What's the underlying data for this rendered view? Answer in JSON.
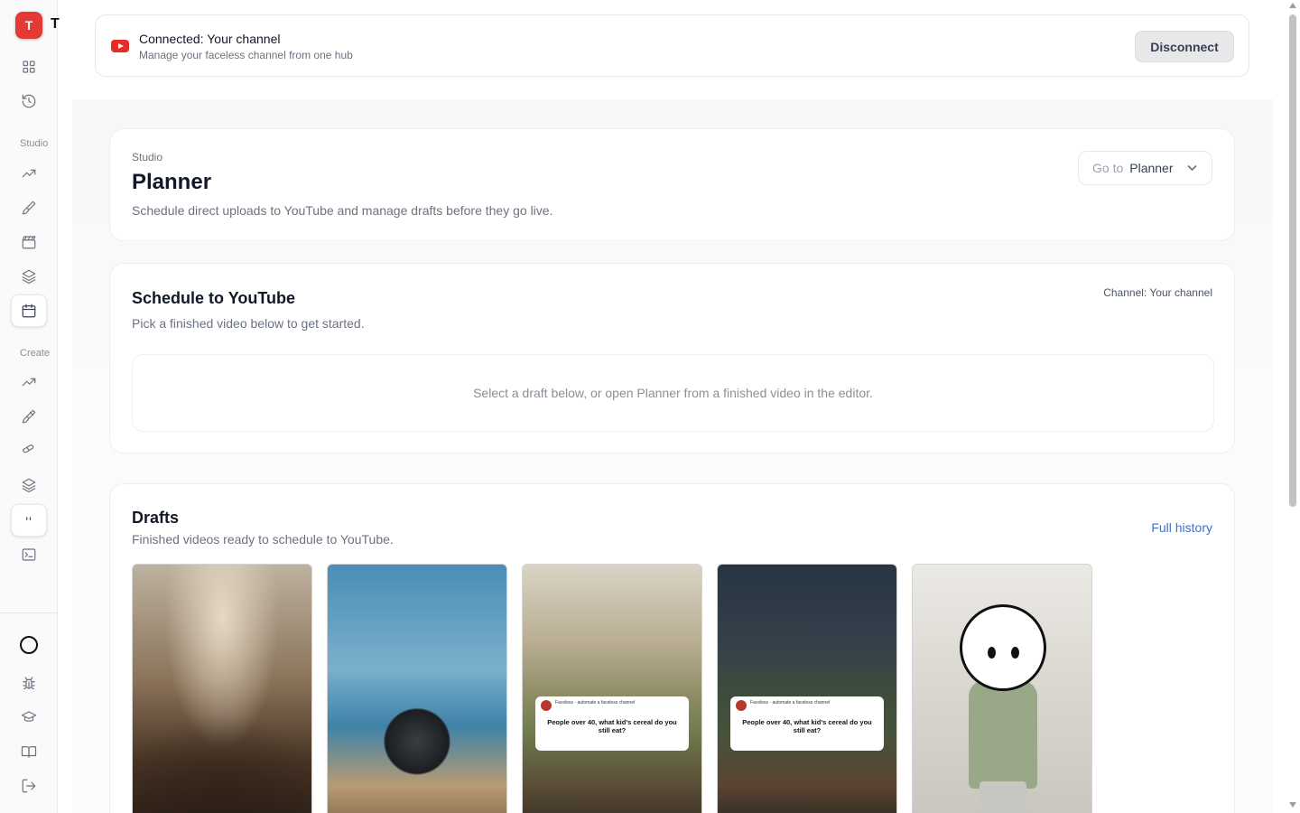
{
  "app": {
    "logo_letter": "T",
    "logo_text": "T"
  },
  "sidebar": {
    "section_studio": "Studio",
    "section_create": "Create",
    "items": [
      {
        "name": "dashboard",
        "icon": "grid-icon"
      },
      {
        "name": "history",
        "icon": "history-icon"
      },
      {
        "name": "trends",
        "icon": "trending-up-icon"
      },
      {
        "name": "brush",
        "icon": "brush-icon"
      },
      {
        "name": "clapper",
        "icon": "clapperboard-icon"
      },
      {
        "name": "layers",
        "icon": "layers-icon"
      },
      {
        "name": "planner",
        "icon": "calendar-icon",
        "active": true
      },
      {
        "name": "create-trends",
        "icon": "trending-up-icon"
      },
      {
        "name": "create-brush",
        "icon": "paintbrush-icon"
      },
      {
        "name": "create-link",
        "icon": "link-icon"
      },
      {
        "name": "create-layers",
        "icon": "layers-icon"
      },
      {
        "name": "quote",
        "icon": "quote-icon"
      },
      {
        "name": "terminal",
        "icon": "terminal-icon"
      },
      {
        "name": "bug",
        "icon": "bug-icon"
      },
      {
        "name": "learn",
        "icon": "graduation-cap-icon"
      },
      {
        "name": "docs",
        "icon": "book-icon"
      },
      {
        "name": "logout",
        "icon": "log-out-icon"
      }
    ]
  },
  "connection": {
    "title": "Connected: Your channel",
    "subtitle": "Manage your faceless channel from one hub",
    "disconnect_label": "Disconnect",
    "brand_color": "#e52d27"
  },
  "planner": {
    "eyebrow": "Studio",
    "title": "Planner",
    "subtitle": "Schedule direct uploads to YouTube and manage drafts before they go live.",
    "goto_prefix": "Go to",
    "goto_value": "Planner"
  },
  "schedule": {
    "title": "Schedule to YouTube",
    "subtitle": "Pick a finished video below to get started.",
    "channel_label": "Channel: Your channel",
    "empty_message": "Select a draft below, or open Planner from a finished video in the editor."
  },
  "drafts": {
    "title": "Drafts",
    "subtitle": "Finished videos ready to schedule to YouTube.",
    "full_history_label": "Full history",
    "link_color": "#3b6fd6",
    "items": [
      {
        "kind": "image",
        "description": "man-with-horn-street"
      },
      {
        "kind": "image",
        "description": "sphere-on-beach"
      },
      {
        "kind": "post",
        "handle": "Faceless · automate a faceless channel",
        "text": "People over 40, what kid's cereal do you still eat?"
      },
      {
        "kind": "post",
        "handle": "Faceless · automate a faceless channel",
        "text": "People over 40, what kid's cereal do you still eat?"
      },
      {
        "kind": "image",
        "description": "cartoon-character-street"
      }
    ]
  }
}
